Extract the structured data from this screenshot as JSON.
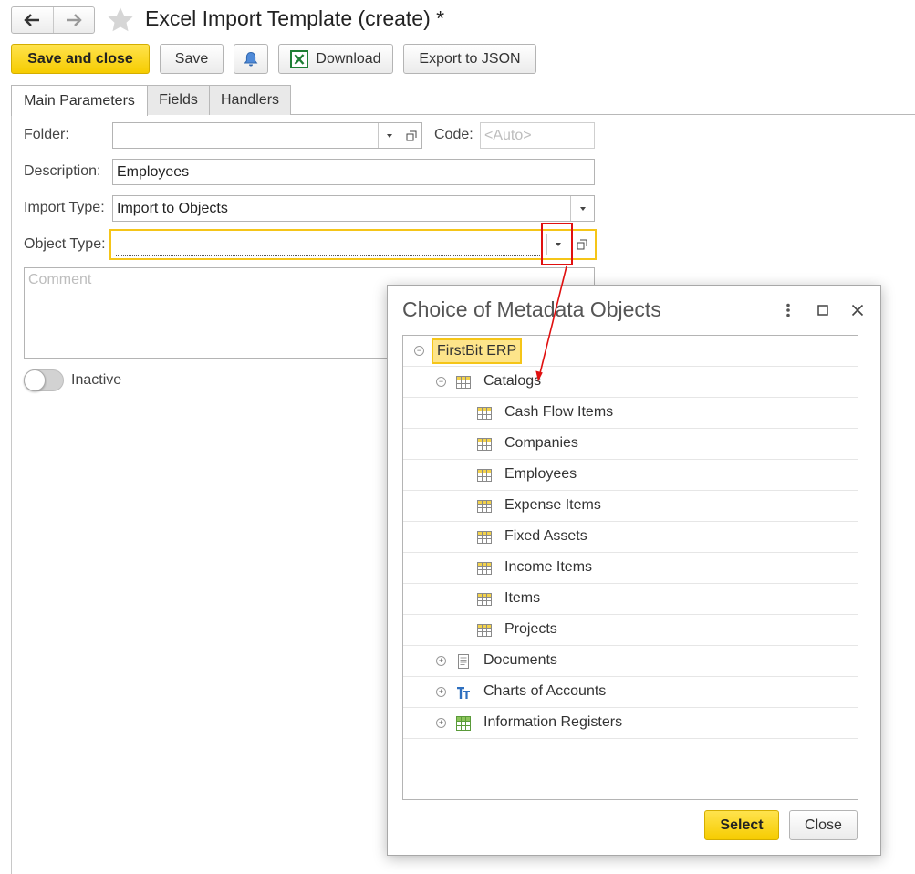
{
  "window": {
    "title": "Excel Import Template (create) *"
  },
  "toolbar": {
    "save_close": "Save and close",
    "save": "Save",
    "download": "Download",
    "export_json": "Export to JSON"
  },
  "tabs": [
    {
      "label": "Main Parameters",
      "active": true
    },
    {
      "label": "Fields",
      "active": false
    },
    {
      "label": "Handlers",
      "active": false
    }
  ],
  "form": {
    "folder_label": "Folder:",
    "folder_value": "",
    "code_label": "Code:",
    "code_placeholder": "<Auto>",
    "description_label": "Description:",
    "description_value": "Employees",
    "import_type_label": "Import Type:",
    "import_type_value": "Import to Objects",
    "object_type_label": "Object Type:",
    "object_type_value": "",
    "comment_placeholder": "Comment",
    "inactive_label": "Inactive",
    "inactive_on": false
  },
  "dialog": {
    "title": "Choice of Metadata Objects",
    "root": "FirstBit ERP",
    "catalogs": "Catalogs",
    "catalog_items": [
      "Cash Flow Items",
      "Companies",
      "Employees",
      "Expense Items",
      "Fixed Assets",
      "Income Items",
      "Items",
      "Projects"
    ],
    "documents": "Documents",
    "charts_of_accounts": "Charts of Accounts",
    "information_registers": "Information Registers",
    "select_label": "Select",
    "close_label": "Close"
  },
  "colors": {
    "accent_yellow": "#f6cc00",
    "highlight": "#fde48a",
    "annotation_red": "#e01010",
    "excel_green": "#1e7e34"
  }
}
